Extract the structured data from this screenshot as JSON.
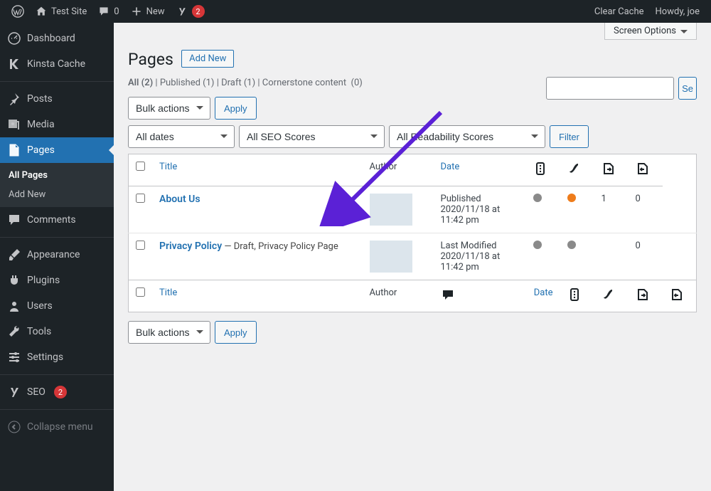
{
  "adminbar": {
    "site_name": "Test Site",
    "comments": "0",
    "new": "New",
    "yoast_count": "2",
    "clear_cache": "Clear Cache",
    "howdy": "Howdy, joe"
  },
  "sidebar": {
    "dashboard": "Dashboard",
    "kinsta": "Kinsta Cache",
    "posts": "Posts",
    "media": "Media",
    "pages": "Pages",
    "all_pages": "All Pages",
    "add_new": "Add New",
    "comments": "Comments",
    "appearance": "Appearance",
    "plugins": "Plugins",
    "users": "Users",
    "tools": "Tools",
    "settings": "Settings",
    "seo": "SEO",
    "seo_count": "2",
    "collapse": "Collapse menu"
  },
  "page": {
    "screen_options": "Screen Options",
    "title": "Pages",
    "add_new": "Add New",
    "filters": {
      "all": "All",
      "all_n": "(2)",
      "published": "Published",
      "published_n": "(1)",
      "draft": "Draft",
      "draft_n": "(1)",
      "cornerstone": "Cornerstone content",
      "cornerstone_n": "(0)"
    },
    "bulk_actions": "Bulk actions",
    "apply": "Apply",
    "all_dates": "All dates",
    "all_seo": "All SEO Scores",
    "all_read": "All Readability Scores",
    "filter": "Filter",
    "search_btn": "Se"
  },
  "table": {
    "h_title": "Title",
    "h_author": "Author",
    "h_date": "Date"
  },
  "rows": [
    {
      "title": "About Us",
      "suffix": "",
      "status": "Published",
      "dateline": "2020/11/18 at 11:42 pm",
      "dot1": "grey",
      "dot2": "orange",
      "links_in": "1",
      "links_out": "0"
    },
    {
      "title": "Privacy Policy",
      "suffix": " — Draft, Privacy Policy Page",
      "status": "Last Modified",
      "dateline": "2020/11/18 at 11:42 pm",
      "dot1": "grey",
      "dot2": "grey",
      "links_in": "",
      "links_out": "0"
    }
  ]
}
